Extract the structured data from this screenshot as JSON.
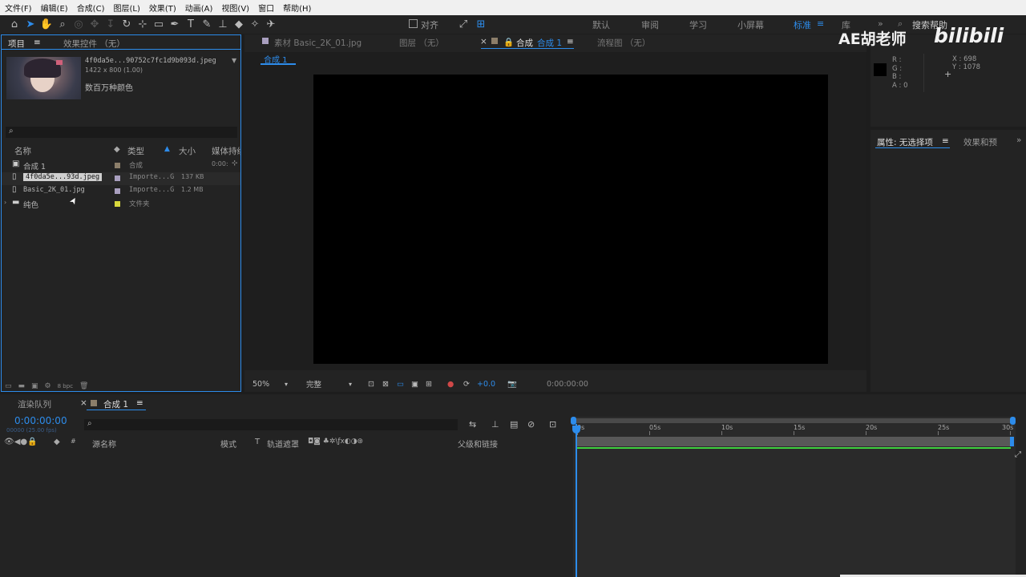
{
  "menu": [
    "文件(F)",
    "编辑(E)",
    "合成(C)",
    "图层(L)",
    "效果(T)",
    "动画(A)",
    "视图(V)",
    "窗口",
    "帮助(H)"
  ],
  "toolbar": {
    "align_label": "对齐",
    "workspaces": [
      "默认",
      "审阅",
      "学习",
      "小屏幕",
      "标准",
      "库"
    ],
    "active_workspace": "标准",
    "more": "»",
    "search_placeholder": "搜索帮助"
  },
  "watermark": {
    "text": "AE胡老师",
    "brand": "bilibili"
  },
  "project": {
    "tab_project": "项目",
    "tab_menu": "≡",
    "tab_effects": "效果控件 （无）",
    "preview": {
      "filename": "4f0da5e...90752c7fc1d9b093d.jpeg",
      "dims": "1422 x 800 (1.00)",
      "usage": "数百万种颜色"
    },
    "search_placeholder": "",
    "columns": {
      "name": "名称",
      "type": "类型",
      "size": "大小",
      "media": "媒体持续"
    },
    "items": [
      {
        "name": "合成 1",
        "type": "合成",
        "size": "",
        "duration": "0:00:",
        "color": "#8c7e6a",
        "icon": "comp-icon"
      },
      {
        "name": "4f0da5e...93d.jpeg",
        "type": "Importe...G",
        "size": "137 KB",
        "duration": "",
        "color": "#a99fbf",
        "icon": "file-icon",
        "selected": true
      },
      {
        "name": "Basic_2K_01.jpg",
        "type": "Importe...G",
        "size": "1.2 MB",
        "duration": "",
        "color": "#a99fbf",
        "icon": "file-icon"
      },
      {
        "name": "纯色",
        "type": "文件夹",
        "size": "",
        "duration": "",
        "color": "#d8d83c",
        "icon": "folder-icon"
      }
    ],
    "bpc": "8 bpc"
  },
  "comp_panel": {
    "tab_footage": "素材 Basic_2K_01.jpg",
    "tab_layer": "图层 （无）",
    "tab_comp": "合成",
    "tab_comp_name": "合成 1",
    "tab_flow": "流程图 （无）",
    "breadcrumb": "合成 1",
    "zoom": "50%",
    "resolution": "完整",
    "exposure": "+0.0",
    "timecode": "0:00:00:00"
  },
  "info_panel": {
    "r": "R :",
    "g": "G :",
    "b": "B :",
    "a": "A : 0",
    "x": "X : 698",
    "y": "Y : 1078",
    "props_tab": "属性: 无选择项",
    "effects_tab": "效果和预"
  },
  "timeline": {
    "tab_render": "渲染队列",
    "tab_comp": "合成 1",
    "timecode": "0:00:00:00",
    "fps": "00000 (25.00 fps)",
    "col_source": "源名称",
    "col_mode": "模式",
    "col_t": "T",
    "col_track": "轨道遮罩",
    "col_parent": "父级和链接",
    "ruler": [
      "0s",
      "05s",
      "10s",
      "15s",
      "20s",
      "25s",
      "30s"
    ]
  }
}
